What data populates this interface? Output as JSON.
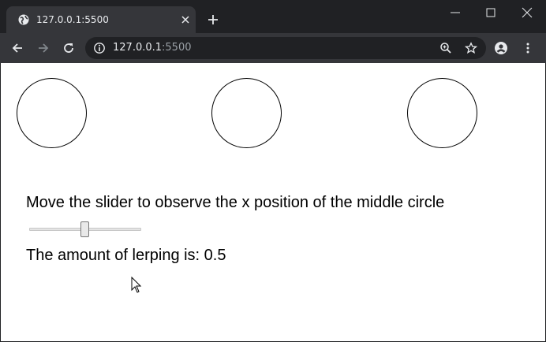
{
  "browser": {
    "tab_title": "127.0.0.1:5500",
    "url_host": "127.0.0.1",
    "url_port": ":5500",
    "icons": {
      "favicon": "globe-icon",
      "tab_close": "close-icon",
      "new_tab": "plus-icon",
      "minimize": "minimize-icon",
      "maximize": "maximize-icon",
      "close_window": "close-window-icon",
      "back": "back-arrow-icon",
      "forward": "forward-arrow-icon",
      "reload": "reload-icon",
      "site_info": "info-icon",
      "zoom": "zoom-icon",
      "bookmark": "star-icon",
      "profile": "profile-icon",
      "menu": "menu-dots-icon"
    },
    "colors": {
      "frame": "#202124",
      "toolbar": "#35363a",
      "text": "#e8eaed",
      "muted": "#9aa0a6"
    }
  },
  "page": {
    "instruction": "Move the slider to observe the x position of the middle circle",
    "lerp_text": "The amount of lerping is: 0.5",
    "slider_value": 0.5
  }
}
